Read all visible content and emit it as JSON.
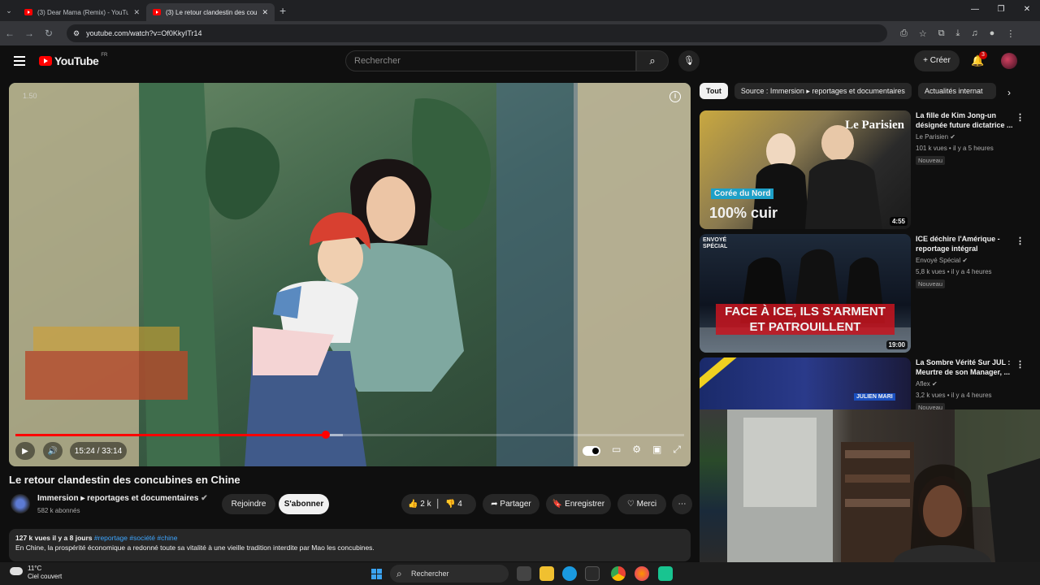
{
  "browser": {
    "tabs": [
      {
        "label": "(3) Dear Mama (Remix) - YouTu",
        "active": false
      },
      {
        "label": "(3) Le retour clandestin des cou",
        "active": true
      }
    ],
    "url": "youtube.com/watch?v=Of0KkyITr14"
  },
  "youtube": {
    "logo_text": "YouTube",
    "region": "FR",
    "search_placeholder": "Rechercher",
    "create_label": "Créer",
    "notif_count": "3"
  },
  "player": {
    "speed_badge": "1.50",
    "time": "15:24 / 33:14",
    "progress": 0.464,
    "buffered": 0.49
  },
  "video": {
    "title": "Le retour clandestin des concubines en Chine",
    "channel": "Immersion ▸ reportages et documentaires",
    "subscribers": "582 k abonnés",
    "join_label": "Rejoindre",
    "subscribe_label": "S'abonner",
    "likes": "2 k",
    "dislikes": "4",
    "share_label": "Partager",
    "save_label": "Enregistrer",
    "thanks_label": "Merci",
    "description": {
      "meta": "127 k vues  il y a 8 jours",
      "tags": "#reportage #société #chine",
      "text": "En Chine, la prospérité économique a redonné toute sa vitalité à une vieille tradition interdite par Mao  les concubines."
    }
  },
  "chips": [
    "Tout",
    "Source : Immersion ▸ reportages et documentaires",
    "Actualités internat"
  ],
  "recommendations": [
    {
      "title": "La fille de Kim Jong-un désignée future dictatrice ...",
      "channel": "Le Parisien",
      "meta": "101 k vues • il y a 5 heures",
      "badge": "Nouveau",
      "duration": "4:55",
      "thumb_brand": "Le Parisien",
      "thumb_tag": "Corée du Nord",
      "thumb_caption": "100% cuir"
    },
    {
      "title": "ICE déchire l'Amérique - reportage intégral",
      "channel": "Envoyé Spécial",
      "meta": "5,8 k vues • il y a 4 heures",
      "badge": "Nouveau",
      "duration": "19:00",
      "thumb_brand": "ENVOYÉ SPÉCIAL",
      "thumb_caption": "FACE À ICE, ILS S'ARMENT ET PATROUILLENT"
    },
    {
      "title": "La Sombre Vérité Sur JUL : Meurtre de son Manager, ...",
      "channel": "Aflex",
      "meta": "3,2 k vues • il y a 4 heures",
      "badge": "Nouveau",
      "thumb_caption": "JULIEN MARI"
    }
  ],
  "taskbar": {
    "temp": "11°C",
    "weather": "Ciel couvert",
    "search_label": "Rechercher"
  }
}
